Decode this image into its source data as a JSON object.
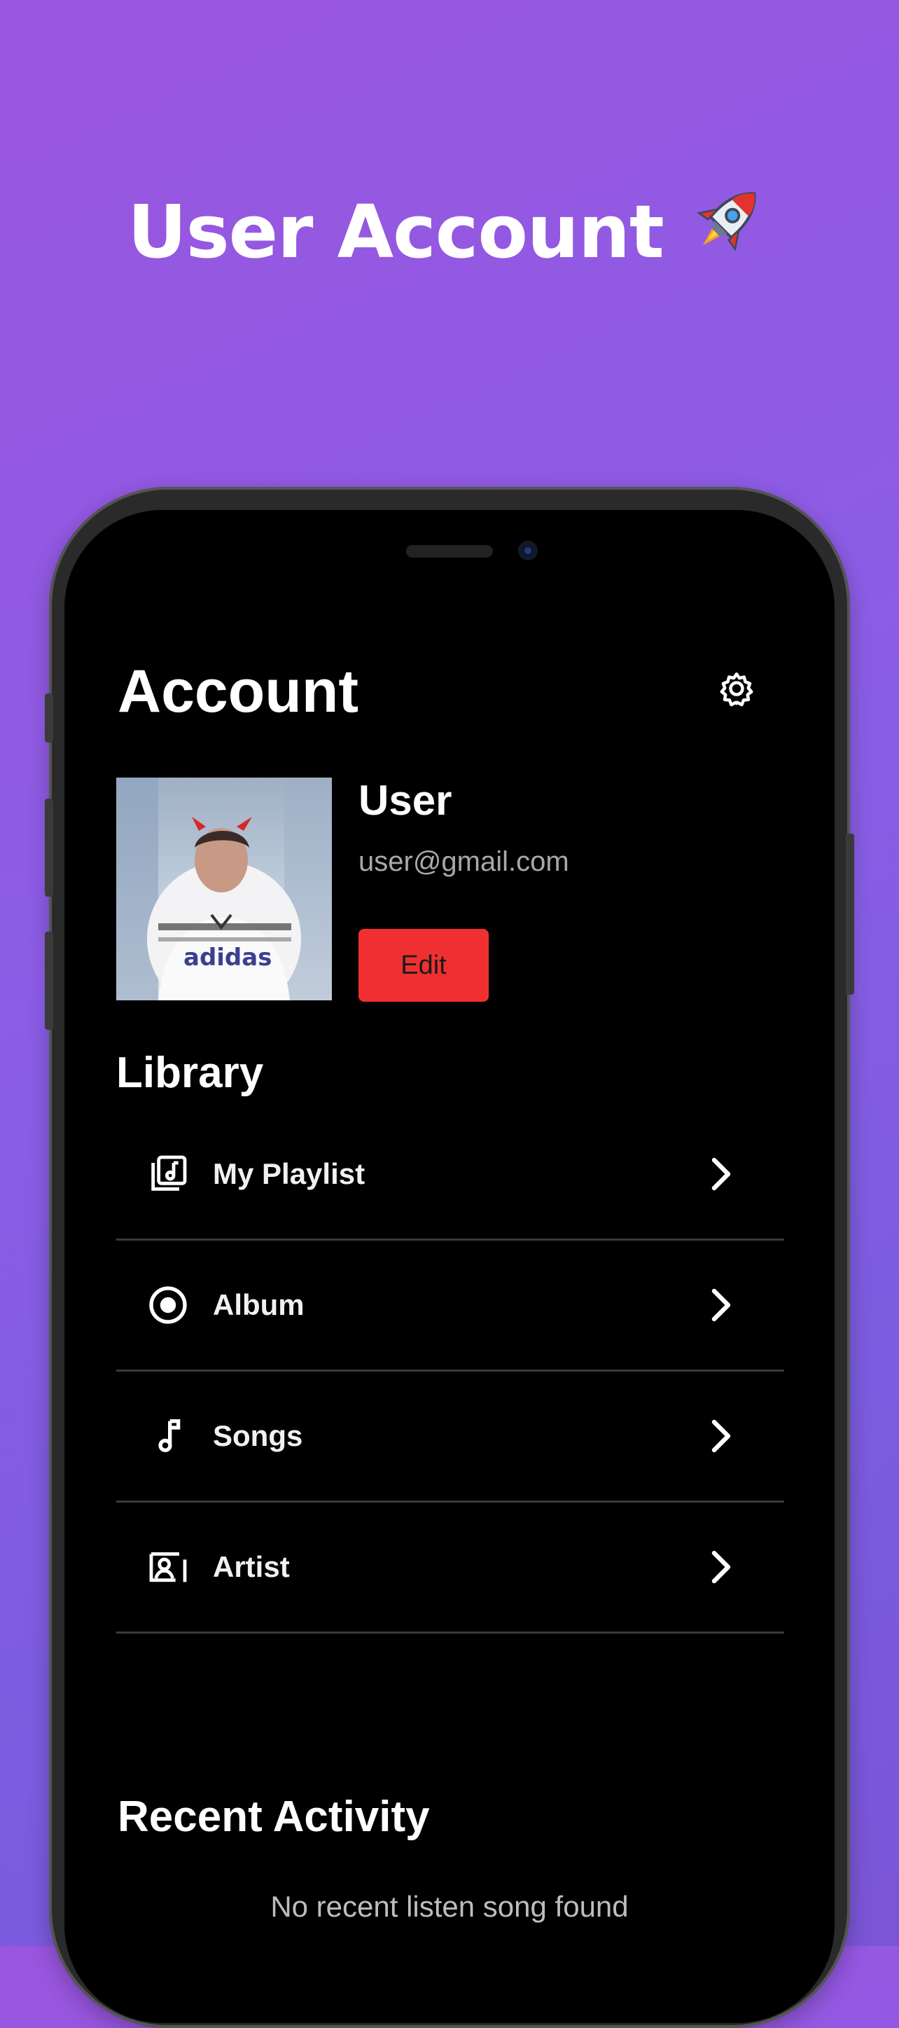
{
  "banner": {
    "title": "User Account",
    "emoji_icon": "rocket-icon"
  },
  "screen": {
    "title": "Account",
    "settings_icon": "gear-icon",
    "profile": {
      "name": "User",
      "email": "user@gmail.com",
      "edit_label": "Edit"
    },
    "library": {
      "title": "Library",
      "items": [
        {
          "label": "My Playlist",
          "icon": "playlist-icon"
        },
        {
          "label": "Album",
          "icon": "album-disc-icon"
        },
        {
          "label": "Songs",
          "icon": "music-note-icon"
        },
        {
          "label": "Artist",
          "icon": "artist-icon"
        }
      ]
    },
    "recent": {
      "title": "Recent Activity",
      "empty_text": "No recent listen song found"
    }
  },
  "colors": {
    "background_gradient_start": "#9a55de",
    "background_gradient_end": "#7a55d6",
    "edit_button": "#f03030",
    "screen_background": "#000000",
    "divider": "#3a3a3a"
  }
}
